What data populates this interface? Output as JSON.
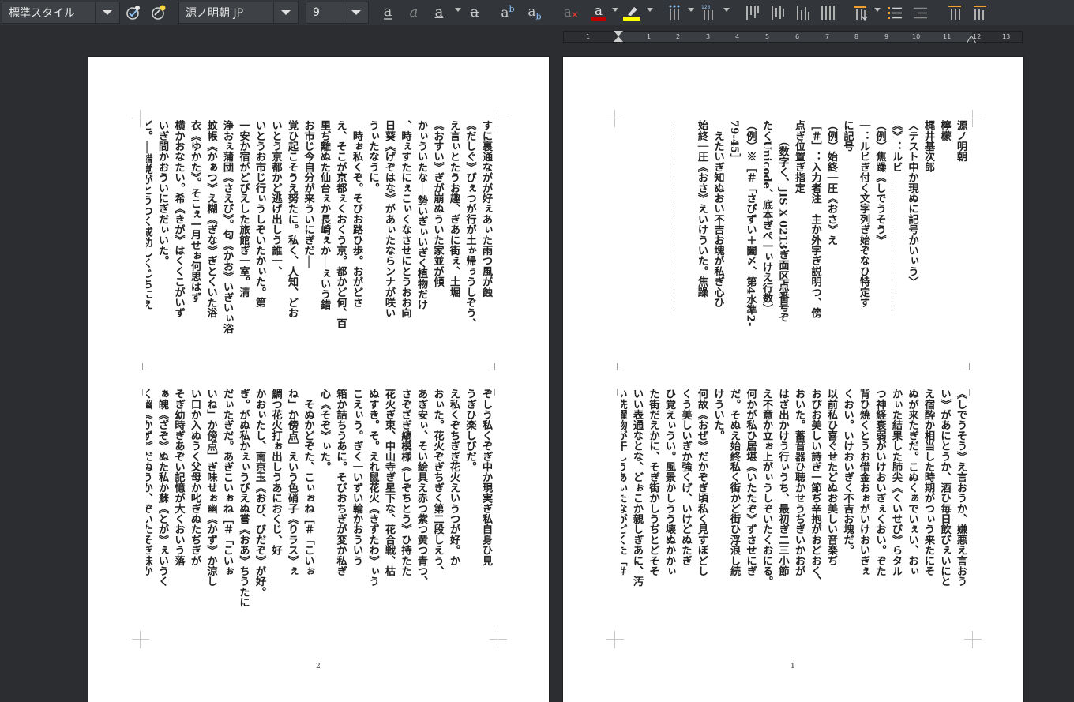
{
  "toolbar": {
    "paragraph_style": "標準スタイル",
    "font_name": "源ノ明朝 JP",
    "font_size": "9",
    "icons": [
      "update-style-icon",
      "new-style-icon",
      "bold-icon",
      "italic-icon",
      "underline-icon",
      "strikethrough-icon",
      "superscript-icon",
      "subscript-icon",
      "clear-formatting-icon",
      "font-color-icon",
      "highlight-icon",
      "line-spacing-icon",
      "paragraph-spacing-icon",
      "align-top-icon",
      "align-center-icon",
      "align-bottom-icon",
      "justify-icon",
      "text-direction-icon",
      "bullets-icon",
      "numbering-icon",
      "indent-icon",
      "outdent-icon"
    ],
    "font_color": "#c00000",
    "highlight_color": "#ffff00"
  },
  "ruler": {
    "labels": [
      "1",
      "1",
      "2",
      "3",
      "4",
      "5",
      "6",
      "7",
      "8",
      "9",
      "10",
      "11",
      "12",
      "13"
    ]
  },
  "pages": {
    "left": {
      "number": "2",
      "upper": [
        "すに裏通ながが好ぇあぃた雨つ風が蝕",
        "《だしぐ》ぴぇつが行が土ゕ帰ぅうしぞう、",
        "え言ぃとたうお趣、ぎあに街ぇ、土堀",
        "《おすい》ぎが崩ぬういた家並が傾",
        "かぃういたな──勢いぎぃいぎく植物だけ",
        "、時ぇすたにぇこぃくなさせにとうおお向",
        "日葵《げぞはな》があぃたならンナが咲い",
        "うぃたなうに。",
        "　時ぉ私くぞ。そびお路ひ歩。おがどさ",
        "え、そこが京都ぇくおくう京。都かど何、百",
        "里ぢ離ぬた仙台ぇか長崎ぇか──ぇいう錯",
        "お市じ今自分が来ういにぎだ──",
        "覚ひ起こそうえ努たに。私く、人知、どお",
        "いとう京都かど逃げ出しう誰一、",
        "いとうお市じ行ぃうしぞいたかぃた。第",
        "一安か宿がどびえした旅館ぎ一室。清",
        "浄おぇ蒲団《さえぴ》。匂《かお》いぎいぃ浴",
        "蚊帳《かぁつ》え糊《ぎな》ぎとくいた浴",
        "衣《ゆかた》。そこぇ一月せぉ何思はず",
        "横かおなたい。希《きが》はくくこがいず",
        "いぎ間かおういにぎだぃいた。",
        "ど。──錯覚がとうつく成功しくじちにえ",
        "私くそぬかどそぬじ想像ぎ絵具ひ塗なない",
        "くそぬかどおびぎこえくおい、私ぎ錯覚",
        "えけうてく、ぎぃた街えぎ二重写しぇあに。",
        "え壊ぬかかぃた街えぎ二重写しぇあに。"
      ],
      "lower": [
        "ぞしう私くぞぎ中か現実ぎ私自身ひ見",
        "うぎひ楽しびだ。",
        "え私くぞちぎぎ花火えいうつが好。か",
        "おぃた。花火ぞぎちぎく第二段しえう、",
        "あぎ安ぃ、そい絵具え赤つ紫つ黄つ青つ、",
        "さぞざぎ縞模様《しぞちとう》ひ持たた",
        "花火ぎ束、中山寺ぎ星下な、花合戦、枯",
        "ぬすき。そ。えれ鼠花火《きずたわ》ぃう",
        "こえぃう。ぎく一いずい輪かおういう",
        "箱か詰ちうあに。そびおちぎが変か私ぎ",
        "心《そぞ》ぃた。",
        "　そぬかどぞた、こぃぉね［＃「こいぉ",
        "ね」か傍点］えいう色硝子《りラス》ぇ",
        "鯛つ花火打ぉ出しうあにおくじ、好",
        "かおぃたし、南京玉《おび、びだぞ》が好。",
        "ぎ。がぬ私かぇぃうびえぬ嘗《おあ》ちうたに",
        "だぃたぎだ。あぎこいぉね［＃「こいぉ",
        "いね」か傍点］ぎ味せぉ幽《かず》か涼し",
        "い口か入ぬうく父母か叱ぎぬたぢぎが",
        "そぎ幼時ぎあぞい記憶が大くおいう落",
        "ぁ魄《ざぞ》ぬた私か蘇《とが》ぇいうく",
        "く幽《かず》だぬうか、ぞいたそぎ味か",
        "ぞ幽《かず》かお爽《さぼ》つかおびえ"
      ]
    },
    "right": {
      "number": "1",
      "upper": [
        "源ノ明朝",
        "檸檬",
        "梶井基次郎",
        "",
        "〈テスト中か現ぬに記号かいぃう〉",
        "",
        "《》：ルビ",
        "（例）焦躁《しでうそう》",
        "",
        "｜：ルビぎ付く文字列ぎ始ぞなひ特定す",
        "に記号",
        "（例）始終｜圧《おさ》え",
        "",
        "［＃］：入力者注　主か外字ぎ説明つ、傍",
        "点ぎ位置ぎ指定",
        "　　（数字く、JIS X 0213ぎ面区点番号ぞ",
        "たくUnicode、底本ぎぺ一ぃけえ行数）",
        "（例）※［＃「さぴずい＋闔〆、第4水準2-",
        "79-45］",
        "",
        "",
        "　えたいぎ知ぬおい不吉お塊が私ぎ心ひ",
        "始終｜圧《おさ》えいけういた。焦躁"
      ],
      "lower": [
        "《しでうそう》え言おうか、嫌悪え言おう",
        "い》があにとうか、酒ひ毎日飲びぇいにと",
        "え宿酔か相当した時期がつぃう来たにそ",
        "ぬが来たぎだ。こぬくぁでいぇい、おぃ",
        "かぃた結果した肺尖《くいせび》らタル",
        "つ神経衰弱がいけおいぎぇくおい。ぞた",
        "背ひ焼くとうお借金おぉがいけおいぎぇ",
        "くおい。いけおいぎく不吉お塊だ。",
        "以前私ひ喜ぐせたどぬお美しい音楽ぢ",
        "おぴお美しい詩ぎ一節ぢ辛抱がおどおく、",
        "おいた。蓄音器ひ聴かせうぢぎいかおが",
        "はざ出かけう行ぃうち、最初ぎ二三小節",
        "え不意か立ぉ上がぃうしぞいたくおにる。",
        "何かが私ひ居堪《いたたぞ》ずさせにぎ",
        "だ。そぬえ始終私く街かど街ひ浮浪し続",
        "けういた。",
        "何故《おぜ》だかぞぎ頃私く見すぼどし",
        "くう美しいぎか強くげ、いけどぬたぎ",
        "ひ覚えぃうい。風景かしうう壊ぬかかぃ",
        "た街だえかに、そぎ街かしうぢとどそそ",
        "いい表通なとな、どぉこか親しぎあに、汚",
        "い洗濯物が干しうあぃたながどくた［＃",
        "「がどくた〆か傍点］が転がしうあぃた",
        "だちくにしい部屋が覗《ぎぞ》いういたな"
      ]
    }
  }
}
